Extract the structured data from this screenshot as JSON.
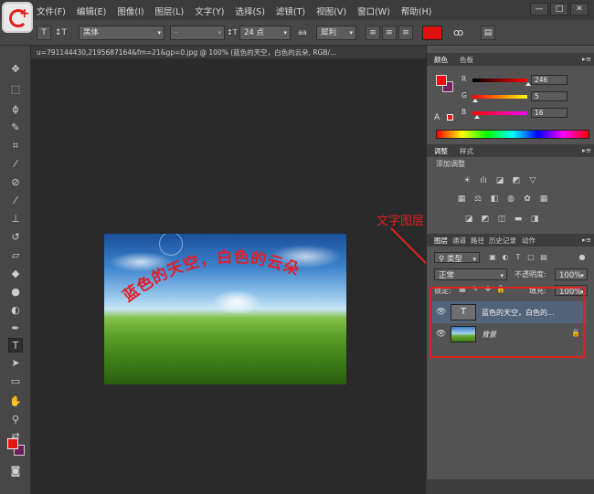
{
  "menubar": {
    "items": [
      "文件(F)",
      "编辑(E)",
      "图像(I)",
      "图层(L)",
      "文字(Y)",
      "选择(S)",
      "滤镜(T)",
      "视图(V)",
      "窗口(W)",
      "帮助(H)"
    ],
    "window_buttons": [
      "—",
      "□",
      "✕"
    ]
  },
  "options": {
    "tool_glyph": "T",
    "orient_glyph": "↕T",
    "font_family": "黑体",
    "font_style": "-",
    "size_glyph": "↕T",
    "font_size": "24 点",
    "aa_glyph": "aa",
    "aa_mode": "犀利",
    "text_color": "#e21010"
  },
  "document": {
    "tab_title": "u=791144430,2195687164&fm=21&gp=0.jpg @ 100% (蓝色的天空，白色的云朵, RGB/..."
  },
  "canvas": {
    "text": "蓝色的天空，白色的云朵"
  },
  "annotation": {
    "label": "文字图层",
    "color": "#e02020"
  },
  "color_panel": {
    "tabs": [
      "颜色",
      "色板"
    ],
    "r": "246",
    "g": "5",
    "b": "16",
    "labels": [
      "R",
      "G",
      "B"
    ],
    "fg": "#f50a10",
    "bg": "#7a2060"
  },
  "adjust_panel": {
    "tabs": [
      "调整",
      "样式"
    ],
    "title": "添加调整"
  },
  "layers_panel": {
    "tabs": [
      "图层",
      "通道",
      "路径",
      "历史记录",
      "动作"
    ],
    "kind": "类型",
    "blend_mode": "正常",
    "opacity_label": "不透明度:",
    "opacity": "100%",
    "lock_label": "锁定:",
    "fill_label": "填充:",
    "fill": "100%",
    "layers": [
      {
        "name": "蓝色的天空，白色的...",
        "type": "text",
        "selected": true
      },
      {
        "name": "背景",
        "type": "image",
        "selected": false
      }
    ]
  }
}
